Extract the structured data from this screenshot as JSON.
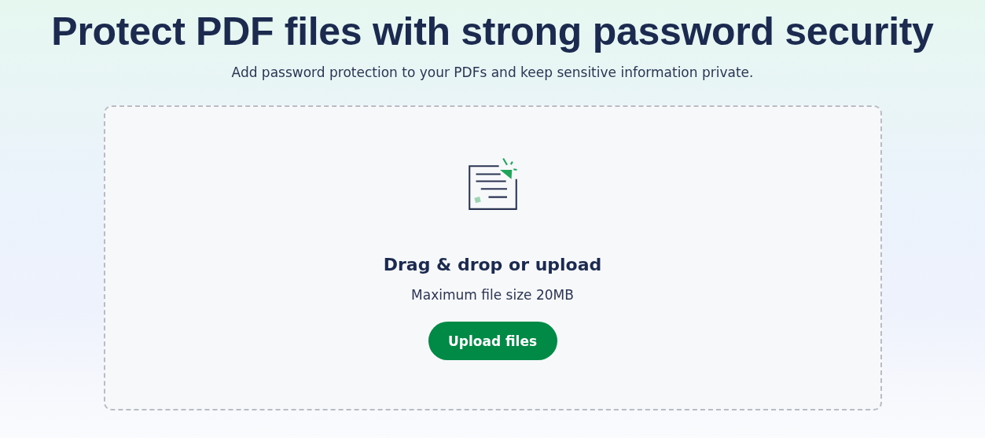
{
  "hero": {
    "title": "Protect PDF files with strong password security",
    "subtitle": "Add password protection to your PDFs and keep sensitive information private."
  },
  "dropzone": {
    "heading": "Drag & drop or upload",
    "hint": "Maximum file size 20MB",
    "button": "Upload files"
  }
}
